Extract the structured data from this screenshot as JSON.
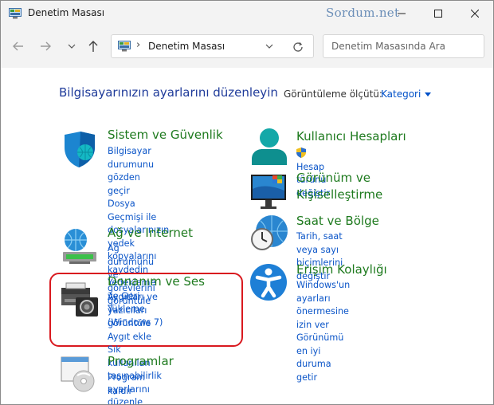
{
  "window": {
    "title": "Denetim Masası",
    "watermark": "Sordum.net"
  },
  "address": {
    "location": "Denetim Masası",
    "search_placeholder": "Denetim Masasında Ara"
  },
  "main": {
    "heading": "Bilgisayarınızın ayarlarını düzenleyin",
    "view_by_label": "Görüntüleme ölçütü:",
    "view_by_value": "Kategori"
  },
  "categories": {
    "security": {
      "title": "Sistem ve Güvenlik",
      "links": [
        "Bilgisayar durumunu gözden",
        "geçir",
        "Dosya Geçmişi ile dosyalarınızın",
        "yedek kopyalarını kaydedin",
        "Yedekleme ve Geri Yükleme",
        "(Windows 7)"
      ]
    },
    "network": {
      "title": "Ağ ve Internet",
      "links": [
        "Ağ durumunu ve görevlerini",
        "görüntüle"
      ]
    },
    "hardware": {
      "title": "Donanım ve Ses",
      "links": [
        "Aygıtları ve yazıcıları görüntüle",
        "Aygıt ekle",
        "Sık kullanılan taşınabilirlik",
        "ayarlarını düzenle"
      ]
    },
    "programs": {
      "title": "Programlar",
      "links": [
        "Program kaldır"
      ]
    },
    "accounts": {
      "title": "Kullanıcı Hesapları",
      "links": [
        "Hesap türünü değiştir"
      ]
    },
    "appearance": {
      "title_line1": "Görünüm ve",
      "title_line2": "Kişiselleştirme"
    },
    "clock": {
      "title": "Saat ve Bölge",
      "links": [
        "Tarih, saat veya sayı biçimlerini",
        "değiştir"
      ]
    },
    "ease": {
      "title": "Erişim Kolaylığı",
      "links": [
        "Windows'un ayarları",
        "önermesine izin ver",
        "Görünümü en iyi duruma getir"
      ]
    }
  },
  "colors": {
    "category_title": "#1e7a1e",
    "link": "#0b55c8",
    "heading": "#1f3b9a",
    "highlight": "#d9191f"
  }
}
